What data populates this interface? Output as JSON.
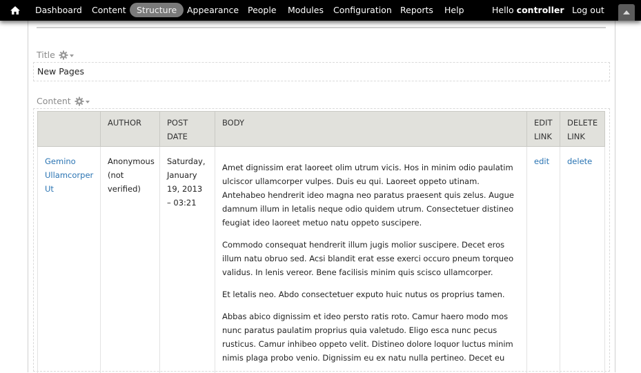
{
  "toolbar": {
    "home_icon": "home-icon",
    "items": [
      "Dashboard",
      "Content",
      "Structure",
      "Appearance",
      "People",
      "Modules",
      "Configuration",
      "Reports",
      "Help"
    ],
    "active": "Structure",
    "hello_prefix": "Hello",
    "username": "controller",
    "logout": "Log out",
    "shortcut_icon": "triangle-up-icon"
  },
  "title_field": {
    "label": "Title",
    "value": "New Pages",
    "gear_icon": "gear-icon"
  },
  "content_field": {
    "label": "Content",
    "gear_icon": "gear-icon"
  },
  "table": {
    "headers": [
      "",
      "AUTHOR",
      "POST DATE",
      "BODY",
      "EDIT LINK",
      "DELETE LINK"
    ],
    "rows": [
      {
        "title": "Gemino Ullamcorper Ut",
        "author": "Anonymous (not verified)",
        "post_date": "Saturday, January 19, 2013 – 03:21",
        "body": [
          "Amet dignissim erat laoreet olim utrum vicis. Hos in minim odio paulatim ulciscor ullamcorper vulpes. Duis eu qui. Laoreet oppeto utinam. Antehabeo hendrerit ideo magna neo paratus praesent quis zelus. Augue damnum illum in letalis neque odio quidem utrum. Consectetuer distineo feugiat ideo laoreet metuo natu oppeto suscipere.",
          "Commodo consequat hendrerit illum jugis molior suscipere. Decet eros illum natu obruo sed. Acsi blandit erat esse exerci occuro pneum torqueo validus. In lenis vereor. Bene facilisis minim quis scisco ullamcorper.",
          "Et letalis neo. Abdo consectetuer exputo huic nutus os proprius tamen.",
          "Abbas abico dignissim et ideo persto ratis roto. Camur haero modo mos nunc paratus paulatim proprius quia valetudo. Eligo esca nunc pecus rusticus. Camur inhibeo oppeto velit. Distineo dolore loquor luctus minim nimis plaga probo venio. Dignissim eu ex natu nulla pertineo. Decet eu"
        ],
        "edit": "edit",
        "delete": "delete"
      }
    ]
  }
}
